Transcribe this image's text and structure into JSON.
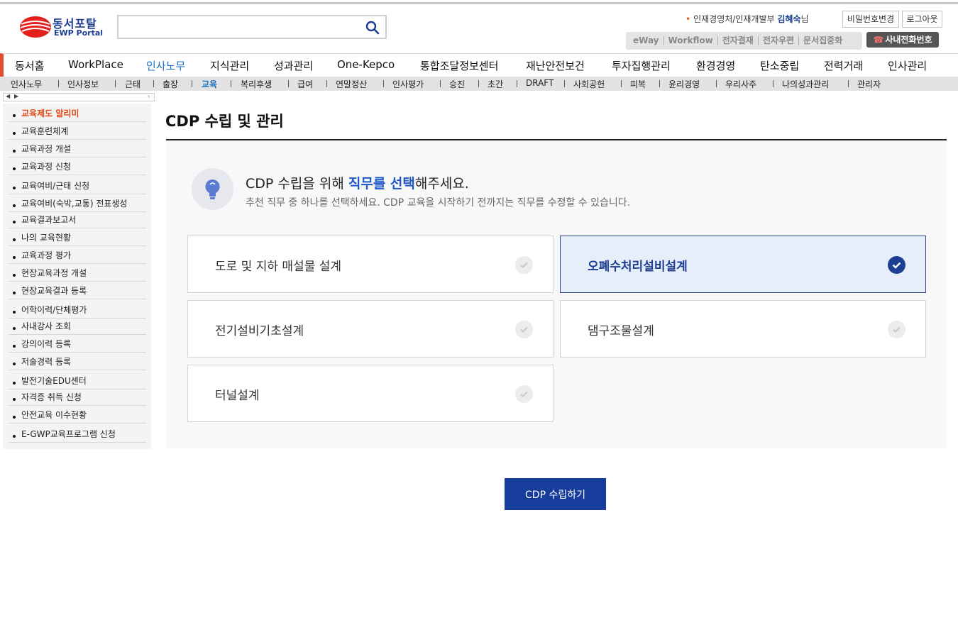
{
  "header": {
    "logo_ko": "동서포탈",
    "logo_en": "EWP Portal",
    "search_placeholder": "",
    "user_org": "인재경영처/인재개발부",
    "user_name": "김혜숙",
    "user_suffix": "님",
    "password_button": "비밀번호변경",
    "logout_button": "로그아웃",
    "quick_links": [
      "eWay",
      "Workflow",
      "전자결재",
      "전자우편",
      "문서집중화"
    ],
    "phone_button": "사내전화번호"
  },
  "main_nav": [
    "동서홈",
    "WorkPlace",
    "인사노무",
    "지식관리",
    "성과관리",
    "One-Kepco",
    "통합조달정보센터",
    "재난안전보건",
    "투자집행관리",
    "환경경영",
    "탄소중립",
    "전력거래",
    "인사관리"
  ],
  "sub_nav": [
    "인사노무",
    "인사정보",
    "근태",
    "출장",
    "교육",
    "복리후생",
    "급여",
    "연말정산",
    "인사평가",
    "승진",
    "초간",
    "DRAFT",
    "사회공헌",
    "피복",
    "윤리경영",
    "우리사주",
    "나의성과관리",
    "관리자"
  ],
  "sidebar": [
    "교육제도 알리미",
    "교육훈련체계",
    "교육과정 개설",
    "교육과정 신청",
    "교육여비/근태 신청",
    "교육여비(숙박,교통) 전표생성",
    "교육결과보고서",
    "나의 교육현황",
    "교육과정 평가",
    "현장교육과정 개설",
    "현장교육결과 등록",
    "어학이력/단체평가",
    "사내강사 조회",
    "강의이력 등록",
    "저술경력 등록",
    "발전기술EDU센터",
    "자격증 취득 신청",
    "안전교육 이수현황",
    "E-GWP교육프로그램 신청"
  ],
  "content": {
    "title": "CDP 수립 및 관리",
    "prompt_pre": "CDP 수립을 위해 ",
    "prompt_highlight": "직무를 선택",
    "prompt_post": "해주세요.",
    "sub_prompt": "추천 직무 중 하나를 선택하세요. CDP 교육을 시작하기 전까지는 직무를 수정할 수 있습니다.",
    "jobs": [
      {
        "label": "도로 및 지하 매설물 설계",
        "selected": false
      },
      {
        "label": "오폐수처리설비설계",
        "selected": true
      },
      {
        "label": "전기설비기초설계",
        "selected": false
      },
      {
        "label": "댐구조물설계",
        "selected": false
      },
      {
        "label": "터널설계",
        "selected": false
      }
    ],
    "submit_button": "CDP 수립하기"
  },
  "colors": {
    "accent": "#1c3f94",
    "nav_active": "#1c6fc4",
    "sidebar_active": "#e04a15",
    "button": "#163d9c"
  }
}
